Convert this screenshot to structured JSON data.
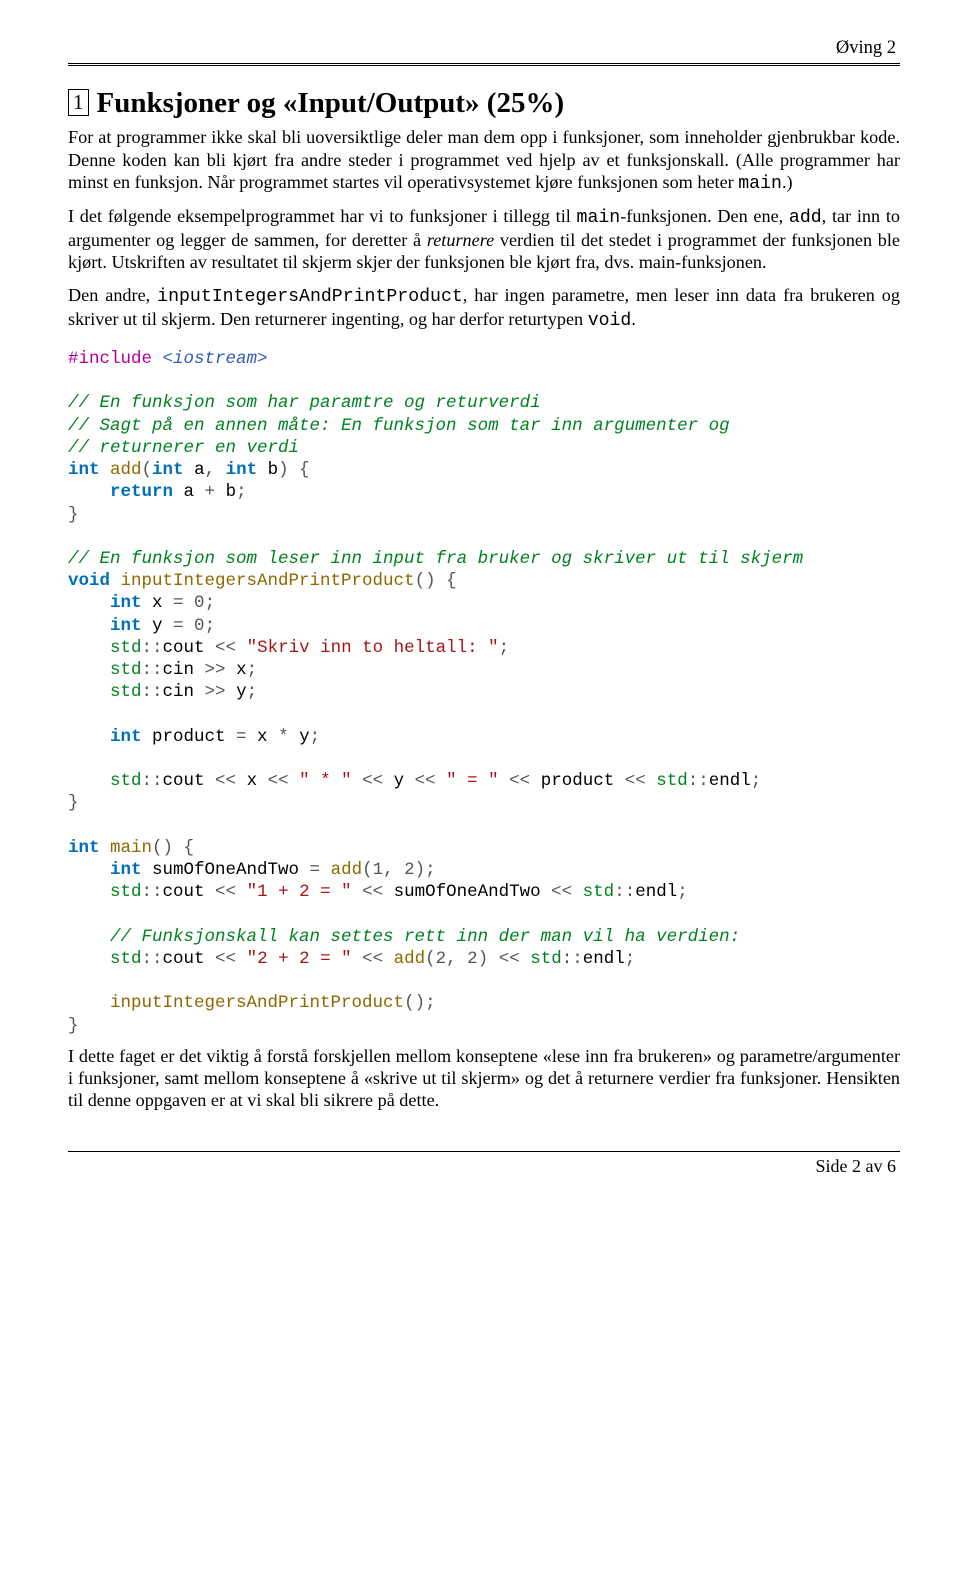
{
  "header": {
    "right": "Øving 2"
  },
  "title": {
    "box": "1",
    "text": "Funksjoner og «Input/Output» (25%)"
  },
  "par": {
    "p1": "For at programmer ikke skal bli uoversiktlige deler man dem opp i funksjoner, som inneholder gjenbrukbar kode. Denne koden kan bli kjørt fra andre steder i programmet ved hjelp av et funksjonskall. (Alle programmer har minst en funksjon. Når programmet startes vil operativsystemet kjøre funksjonen som heter ",
    "p1_tt": "main",
    "p1_end": ".)",
    "p2a": "I det følgende eksempelprogrammet har vi to funksjoner i tillegg til ",
    "p2_tt1": "main",
    "p2b": "-funksjonen. Den ene, ",
    "p2_tt2": "add",
    "p2c": ", tar inn to argumenter og legger de sammen, for deretter å ",
    "p2_em": "returnere",
    "p2d": " verdien til det stedet i programmet der funksjonen ble kjørt. Utskriften av resultatet til skjerm skjer der funksjonen ble kjørt fra, dvs. main-funksjonen.",
    "p3a": "Den andre, ",
    "p3_tt": "inputIntegersAndPrintProduct",
    "p3b": ", har ingen parametre, men leser inn data fra brukeren og skriver ut til skjerm. Den returnerer ingenting, og har derfor returtypen ",
    "p3_tt2": "void",
    "p3c": ".",
    "p4": "I dette faget er det viktig å forstå forskjellen mellom konseptene «lese inn fra brukeren» og parametre/argumenter i funksjoner, samt mellom konseptene å «skrive ut til skjerm» og det å returnere verdier fra funksjoner. Hensikten til denne oppgaven er at vi skal bli sikrere på dette."
  },
  "code": {
    "l1_pre": "#include",
    "l1_hdr": " <iostream>",
    "l3": "// En funksjon som har paramtre og returverdi",
    "l4": "// Sagt på en annen måte: En funksjon som tar inn argumenter og",
    "l5": "// returnerer en verdi",
    "l6_kw1": "int",
    "l6_fn": " add",
    "l6_p1": "(",
    "l6_kw2": "int",
    "l6_a": " a",
    "l6_c": ", ",
    "l6_kw3": "int",
    "l6_b": " b",
    "l6_p2": ") {",
    "l7_kw": "    return",
    "l7_rest": " a ",
    "l7_op": "+",
    "l7_rest2": " b",
    "l7_s": ";",
    "l8": "}",
    "l10": "// En funksjon som leser inn input fra bruker og skriver ut til skjerm",
    "l11_kw": "void",
    "l11_fn": " inputIntegersAndPrintProduct",
    "l11_p": "() {",
    "l12_kw": "    int",
    "l12_r": " x ",
    "l12_eq": "=",
    "l12_v": " 0",
    "l12_s": ";",
    "l13_kw": "    int",
    "l13_r": " y ",
    "l13_eq": "=",
    "l13_v": " 0",
    "l13_s": ";",
    "l14a": "    std",
    "l14_cc": "::",
    "l14b": "cout ",
    "l14_op": "<<",
    "l14_str": " \"Skriv inn to heltall: \"",
    "l14_s": ";",
    "l15a": "    std",
    "l15_cc": "::",
    "l15b": "cin ",
    "l15_op": ">>",
    "l15_r": " x",
    "l15_s": ";",
    "l16a": "    std",
    "l16_cc": "::",
    "l16b": "cin ",
    "l16_op": ">>",
    "l16_r": " y",
    "l16_s": ";",
    "l18_kw": "    int",
    "l18_r": " product ",
    "l18_eq": "=",
    "l18_r2": " x ",
    "l18_op": "*",
    "l18_r3": " y",
    "l18_s": ";",
    "l20a": "    std",
    "l20_cc": "::",
    "l20b": "cout ",
    "l20_op1": "<<",
    "l20_x": " x ",
    "l20_op2": "<<",
    "l20_s1": " \" * \" ",
    "l20_op3": "<<",
    "l20_y": " y ",
    "l20_op4": "<<",
    "l20_s2": " \" = \" ",
    "l20_op5": "<<",
    "l20_p": " product ",
    "l20_op6": "<<",
    "l20_sp": " ",
    "l20_std": "std",
    "l20_cc2": "::",
    "l20_endl": "endl",
    "l20_sc": ";",
    "l21": "}",
    "l23_kw": "int",
    "l23_fn": " main",
    "l23_p": "() {",
    "l24_kw": "    int",
    "l24_r": " sumOfOneAndTwo ",
    "l24_eq": "=",
    "l24_fn": " add",
    "l24_p1": "(",
    "l24_n1": "1",
    "l24_c": ", ",
    "l24_n2": "2",
    "l24_p2": ")",
    "l24_s": ";",
    "l25a": "    std",
    "l25_cc": "::",
    "l25b": "cout ",
    "l25_op1": "<<",
    "l25_str": " \"1 + 2 = \" ",
    "l25_op2": "<<",
    "l25_r": " sumOfOneAndTwo ",
    "l25_op3": "<<",
    "l25_sp": " ",
    "l25_std": "std",
    "l25_cc2": "::",
    "l25_endl": "endl",
    "l25_s": ";",
    "l27": "    // Funksjonskall kan settes rett inn der man vil ha verdien:",
    "l28a": "    std",
    "l28_cc": "::",
    "l28b": "cout ",
    "l28_op1": "<<",
    "l28_str": " \"2 + 2 = \" ",
    "l28_op2": "<<",
    "l28_fn": " add",
    "l28_p1": "(",
    "l28_n1": "2",
    "l28_c": ", ",
    "l28_n2": "2",
    "l28_p2": ") ",
    "l28_op3": "<<",
    "l28_sp": " ",
    "l28_std": "std",
    "l28_cc2": "::",
    "l28_endl": "endl",
    "l28_s": ";",
    "l30_fn": "    inputIntegersAndPrintProduct",
    "l30_p": "()",
    "l30_s": ";",
    "l31": "}"
  },
  "footer": {
    "text": "Side 2 av 6"
  }
}
